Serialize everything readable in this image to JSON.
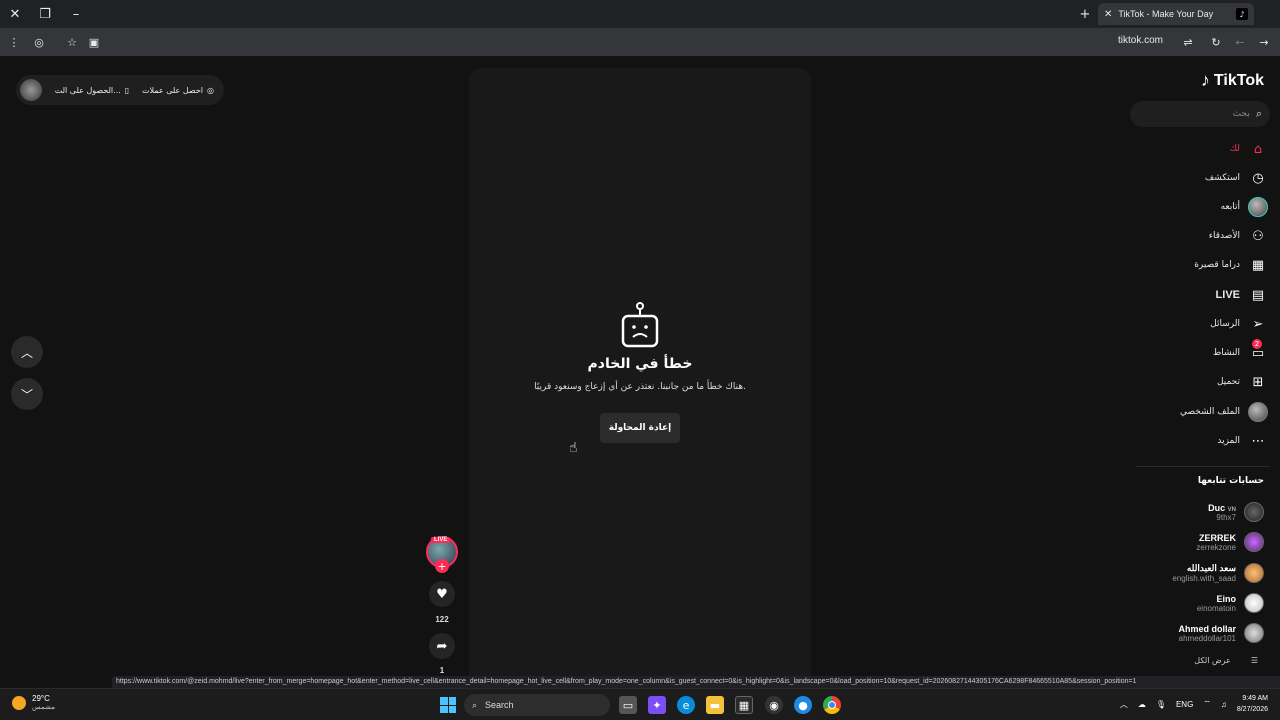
{
  "browser": {
    "tab_title": "TikTok - Make Your Day",
    "url": "tiktok.com",
    "status_url": "https://www.tiktok.com/@zeid.mohmd/live?enter_from_merge=homepage_hot&enter_method=live_cell&entrance_detail=homepage_hot_live_cell&from_play_mode=one_column&is_guest_connect=0&is_highlight=0&is_landscape=0&load_position=10&request_id=20260827144305176CA6298F84665510A85&session_position=1"
  },
  "sidebar": {
    "logo": "TikTok",
    "search_placeholder": "بحث",
    "nav": [
      {
        "label": "لك",
        "icon": "home-icon"
      },
      {
        "label": "استكشف",
        "icon": "compass-icon"
      },
      {
        "label": "أتابعه",
        "icon": "avatar-icon"
      },
      {
        "label": "الأصدقاء",
        "icon": "friends-icon"
      },
      {
        "label": "دراما قصيرة",
        "icon": "drama-icon"
      },
      {
        "label": "LIVE",
        "icon": "live-icon"
      },
      {
        "label": "الرسائل",
        "icon": "send-icon"
      },
      {
        "label": "النشاط",
        "icon": "activity-icon",
        "badge": "2"
      },
      {
        "label": "تحميل",
        "icon": "upload-icon"
      },
      {
        "label": "الملف الشخصي",
        "icon": "profile-icon"
      },
      {
        "label": "المزيد",
        "icon": "more-icon"
      }
    ],
    "following_title": "حسابات تتابعها",
    "accounts": [
      {
        "name": "Duc",
        "badge": "VN",
        "handle": "9thx7"
      },
      {
        "name": "ZERREK",
        "handle": "zerrekzone"
      },
      {
        "name": "سعد العبدالله",
        "handle": "english.with_saad"
      },
      {
        "name": "Eino",
        "handle": "einomatoin"
      },
      {
        "name": "Ahmed dollar",
        "handle": "ahmeddollar101"
      }
    ],
    "see_all": "عرض الكل"
  },
  "top_pill": {
    "get_coins": "احصل على عملات",
    "get_app": "الحصول على الت..."
  },
  "error": {
    "title": "خطأ في الخادم",
    "message": "هناك خطأ ما من جانبنا. نعتذر عن أي إزعاج وسنعود قريبًا.",
    "retry": "إعادة المحاولة"
  },
  "actions": {
    "live_tag": "LIVE",
    "likes": "122",
    "shares": "1"
  },
  "taskbar": {
    "temp": "29°C",
    "weather": "مشمس",
    "search": "Search",
    "lang": "ENG",
    "time": "9:49 AM",
    "date": "8/27/2026"
  }
}
